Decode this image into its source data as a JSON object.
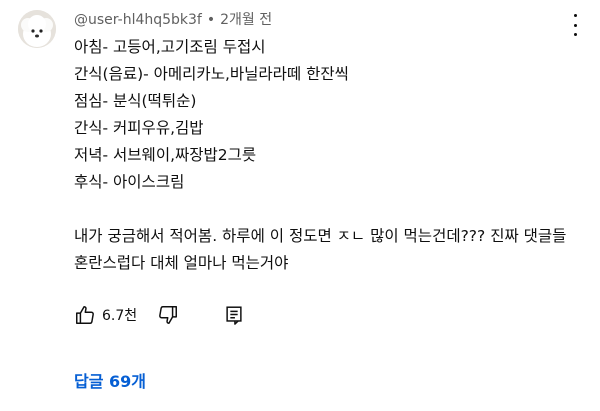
{
  "comment": {
    "username": "@user-hl4hq5bk3f",
    "separator": "•",
    "time": "2개월 전",
    "lines": [
      "아침- 고등어,고기조림 두접시",
      "간식(음료)-  아메리카노,바닐라라떼 한잔씩",
      "점심- 분식(떡튀순)",
      "간식-  커피우유,김밥",
      "저녁- 서브웨이,짜장밥2그릇",
      "후식- 아이스크림"
    ],
    "paragraph": "내가 궁금해서 적어봄. 하루에 이 정도면 ㅈㄴ 많이 먹는건데??? 진짜 댓글들 혼란스럽다 대체 얼마나 먹는거야"
  },
  "actions": {
    "like_count": "6.7천",
    "icons": [
      "thumb-up-icon",
      "thumb-down-icon",
      "reply-icon"
    ]
  },
  "replies": {
    "label": "답글 69개",
    "color": "#065fd4"
  }
}
